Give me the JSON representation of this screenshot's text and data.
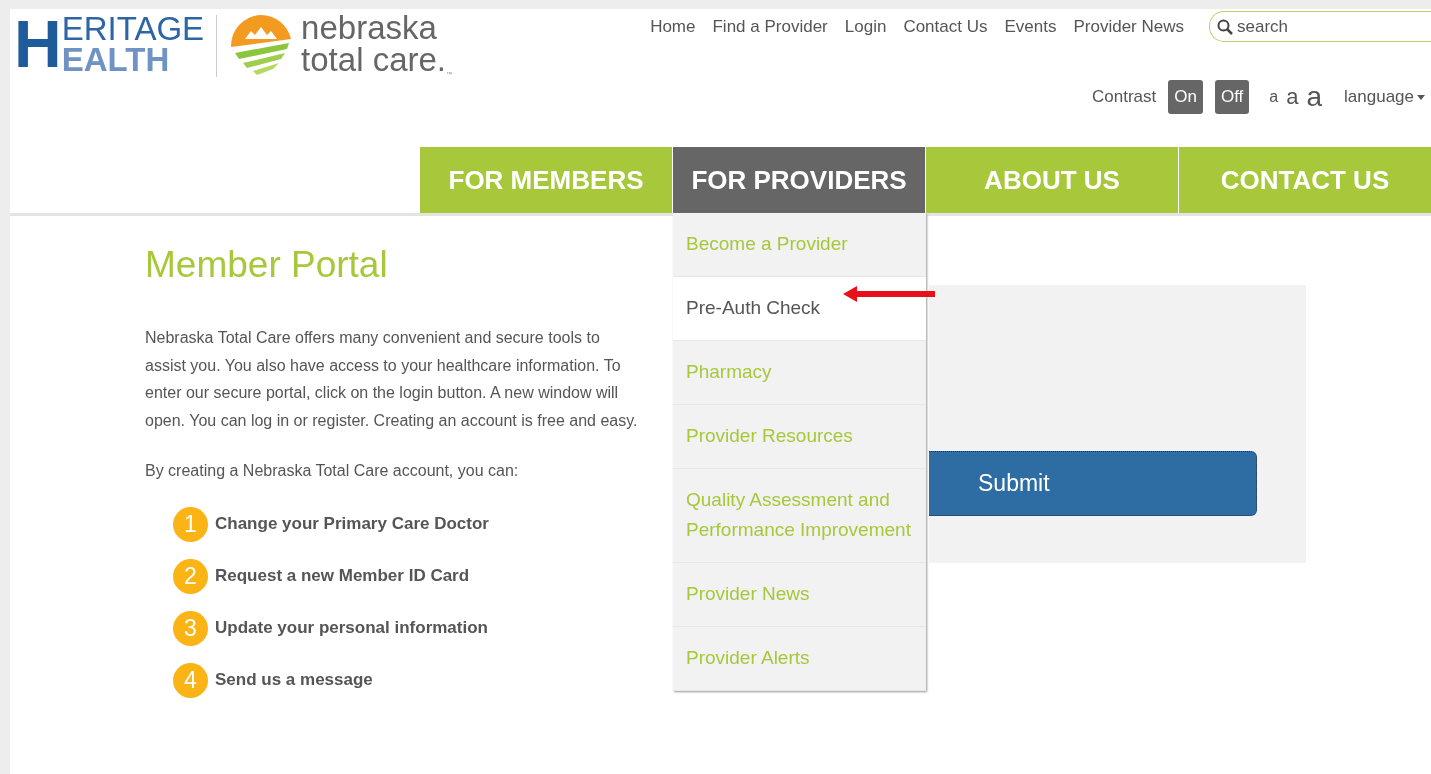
{
  "logo": {
    "heritage": {
      "initial": "H",
      "line1": "ERITAGE",
      "line2": "EALTH"
    },
    "brand": {
      "line1": "nebraska",
      "line2": "total care.",
      "mark": "™"
    }
  },
  "top_nav": [
    "Home",
    "Find a Provider",
    "Login",
    "Contact Us",
    "Events",
    "Provider News"
  ],
  "search": {
    "placeholder": "search"
  },
  "contrast": {
    "label": "Contrast",
    "buttons": [
      "On",
      "Off"
    ]
  },
  "font_sizes": [
    "a",
    "a",
    "a"
  ],
  "language": {
    "label": "language"
  },
  "main_nav": [
    {
      "label": "FOR MEMBERS",
      "selected": false
    },
    {
      "label": "FOR PROVIDERS",
      "selected": true,
      "menu": [
        {
          "label": "Become a Provider",
          "selected": false
        },
        {
          "label": "Pre-Auth Check",
          "selected": true
        },
        {
          "label": "Pharmacy",
          "selected": false
        },
        {
          "label": "Provider Resources",
          "selected": false
        },
        {
          "label": "Quality Assessment and Performance Improvement",
          "selected": false
        },
        {
          "label": "Provider News",
          "selected": false
        },
        {
          "label": "Provider Alerts",
          "selected": false
        }
      ]
    },
    {
      "label": "ABOUT US",
      "selected": false
    },
    {
      "label": "CONTACT US",
      "selected": false
    }
  ],
  "page": {
    "title": "Member Portal",
    "intro": "Nebraska Total Care offers many convenient and secure tools to assist you. You also have access to your healthcare information. To enter our secure portal, click on the login button. A new window will open. You can log in or register. Creating an account is free and easy.",
    "lead": "By creating a Nebraska Total Care account, you can:",
    "steps": [
      {
        "number": "1",
        "text": "Change your Primary Care Doctor"
      },
      {
        "number": "2",
        "text": "Request a new Member ID Card"
      },
      {
        "number": "3",
        "text": "Update your personal information"
      },
      {
        "number": "4",
        "text": "Send us a message"
      }
    ]
  },
  "login_panel": {
    "button": "Submit"
  }
}
